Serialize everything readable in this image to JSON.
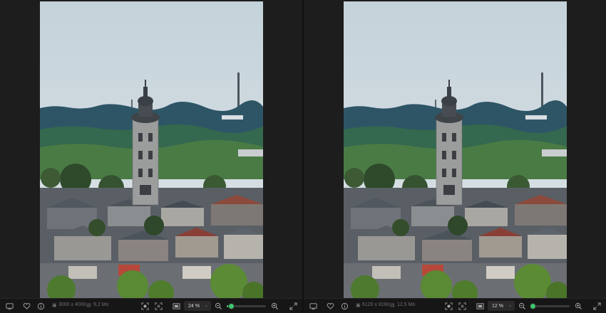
{
  "panes": [
    {
      "dimensions": "3000 x 4000",
      "file_size": "9,2 Mo",
      "zoom": "24 %",
      "zoom_slider_fraction": 0.1
    },
    {
      "dimensions": "6120 x 8160",
      "file_size": "12,5 Mo",
      "zoom": "12 %",
      "zoom_slider_fraction": 0.05
    }
  ],
  "icons": {
    "display": "monitor-icon",
    "favorite": "heart-icon",
    "info": "info-icon",
    "dimensions": "image-size-icon",
    "file_size": "file-icon",
    "fit": "fit-screen-icon",
    "fill": "fill-screen-icon",
    "compare": "compare-icon",
    "zoom_out": "zoom-out-icon",
    "zoom_in": "zoom-in-icon",
    "fullscreen": "fullscreen-icon"
  },
  "colors": {
    "accent": "#3ec46e",
    "background": "#1c1c1c",
    "toolbar": "#161616"
  }
}
